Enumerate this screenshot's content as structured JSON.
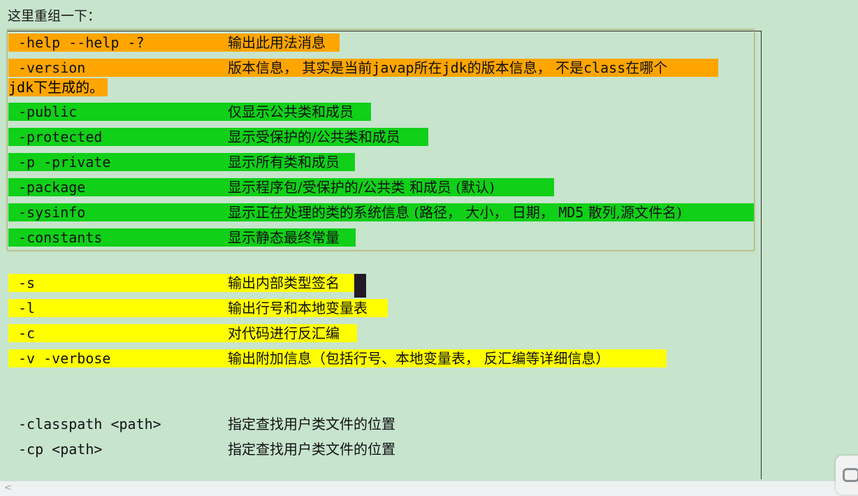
{
  "heading": "这里重组一下：",
  "rows": [
    {
      "opt": "-help  --help  -?",
      "desc": "输出此用法消息",
      "color": "#ffa500"
    },
    {
      "opt": "-version",
      "desc_parts": [
        "版本信息， 其实是当前",
        "javap",
        "所在",
        "jdk",
        "的版本信息， 不是",
        "class",
        "在哪个"
      ],
      "desc_cont_parts": [
        "jdk",
        "下生成的。"
      ],
      "color": "#ffa500"
    },
    {
      "opt": "-public",
      "desc": "仅显示公共类和成员",
      "color": "#10d018"
    },
    {
      "opt": "-protected",
      "desc": "显示受保护的/公共类和成员",
      "color": "#10d018"
    },
    {
      "opt": "-p  -private",
      "desc": "显示所有类和成员",
      "color": "#10d018"
    },
    {
      "opt": "-package",
      "desc": "显示程序包/受保护的/公共类 和成员 (默认)",
      "color": "#10d018"
    },
    {
      "opt": "-sysinfo",
      "desc_parts": [
        "显示正在处理的类的系统信息 (路径， 大小， 日期， ",
        "MD5",
        " 散列,源文件名)"
      ],
      "color": "#10d018"
    },
    {
      "opt": "-constants",
      "desc": "显示静态最终常量",
      "color": "#10d018"
    },
    {
      "opt": "-s",
      "desc": "输出内部类型签名",
      "color": "#ffff00"
    },
    {
      "opt": "-l",
      "desc": "输出行号和本地变量表",
      "color": "#ffff00"
    },
    {
      "opt": "-c",
      "desc": "对代码进行反汇编",
      "color": "#ffff00"
    },
    {
      "opt": "-v  -verbose",
      "desc": "输出附加信息（包括行号、本地变量表， 反汇编等详细信息）",
      "color": "#ffff00"
    },
    {
      "opt": "-classpath <path>",
      "desc": "指定查找用户类文件的位置"
    },
    {
      "opt": "-cp <path>",
      "desc": "指定查找用户类文件的位置"
    }
  ],
  "scrollbar": {
    "left_arrow": "<"
  }
}
